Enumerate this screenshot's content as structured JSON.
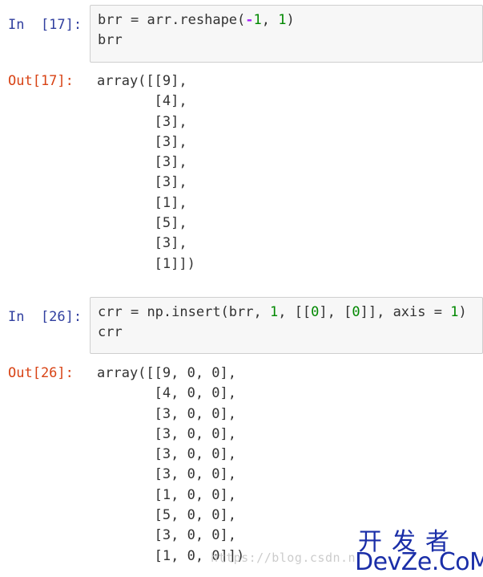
{
  "cells": [
    {
      "in_prompt": "In  [17]:",
      "code_lines": [
        [
          {
            "t": "brr",
            "k": "name"
          },
          {
            "t": " ",
            "k": "name"
          },
          {
            "t": "=",
            "k": "name"
          },
          {
            "t": " arr.reshape(",
            "k": "name"
          },
          {
            "t": "-",
            "k": "op"
          },
          {
            "t": "1",
            "k": "num"
          },
          {
            "t": ", ",
            "k": "name"
          },
          {
            "t": "1",
            "k": "num"
          },
          {
            "t": ")",
            "k": "name"
          }
        ],
        [
          {
            "t": "brr",
            "k": "name"
          }
        ]
      ],
      "out_prompt": "Out[17]:",
      "output_lines": [
        "array([[9],",
        "       [4],",
        "       [3],",
        "       [3],",
        "       [3],",
        "       [3],",
        "       [1],",
        "       [5],",
        "       [3],",
        "       [1]])"
      ]
    },
    {
      "in_prompt": "In  [26]:",
      "code_lines": [
        [
          {
            "t": "crr ",
            "k": "name"
          },
          {
            "t": "=",
            "k": "name"
          },
          {
            "t": " np.insert(brr, ",
            "k": "name"
          },
          {
            "t": "1",
            "k": "num"
          },
          {
            "t": ", [[",
            "k": "name"
          },
          {
            "t": "0",
            "k": "num"
          },
          {
            "t": "], [",
            "k": "name"
          },
          {
            "t": "0",
            "k": "num"
          },
          {
            "t": "]], axis ",
            "k": "name"
          },
          {
            "t": "=",
            "k": "name"
          },
          {
            "t": " ",
            "k": "name"
          },
          {
            "t": "1",
            "k": "num"
          },
          {
            "t": ")",
            "k": "name"
          }
        ],
        [
          {
            "t": "crr",
            "k": "name"
          }
        ]
      ],
      "out_prompt": "Out[26]:",
      "output_lines": [
        "array([[9, 0, 0],",
        "       [4, 0, 0],",
        "       [3, 0, 0],",
        "       [3, 0, 0],",
        "       [3, 0, 0],",
        "       [3, 0, 0],",
        "       [1, 0, 0],",
        "       [5, 0, 0],",
        "       [3, 0, 0],",
        "       [1, 0, 0]])"
      ]
    }
  ],
  "watermark": {
    "url": "https://blog.csdn.n",
    "logo_cn": "开发者",
    "logo_en": "DevZe.CoM"
  },
  "colors": {
    "in_prompt": "#303f9f",
    "out_prompt": "#d84315",
    "number": "#008800",
    "operator": "#aa22ff",
    "input_bg": "#f7f7f7",
    "input_border": "#cfcfcf",
    "logo": "#1a2ea8"
  }
}
